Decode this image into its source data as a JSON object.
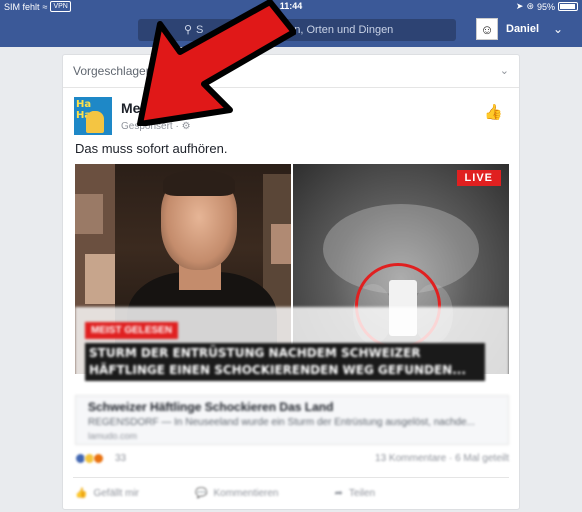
{
  "statusbar": {
    "carrier": "SIM fehlt",
    "vpn": "VPN",
    "time": "11:44",
    "battery": "95%"
  },
  "navbar": {
    "search_placeholder_visible": "S",
    "search_placeholder_rest": "nen, Orten und Dingen",
    "user_name": "Daniel"
  },
  "card": {
    "header": "Vorgeschlagen",
    "page_name": "Mega",
    "avatar_text": "Ha Ha!",
    "sponsored": "Gesponsert",
    "post_text": "Das muss sofort aufhören.",
    "live_badge": "LIVE",
    "tag": "MEIST GELESEN",
    "headline": "STURM DER ENTRÜSTUNG NACHDEM SCHWEIZER HÄFTLINGE EINEN SCHOCKIERENDEN WEG GEFUNDEN...",
    "link_title": "Schweizer Häftlinge Schockieren Das Land",
    "link_desc": "REGENSDORF — In Neuseeland wurde ein Sturm der Entrüstung ausgelöst, nachde...",
    "link_source": "lamudo.com",
    "reaction_count": "33",
    "comments": "13 Kommentare",
    "shares": "6 Mal geteilt",
    "actions": {
      "like": "Gefällt mir",
      "comment": "Kommentieren",
      "share": "Teilen"
    }
  },
  "colors": {
    "brand": "#3b5998",
    "live": "#e02020",
    "arrow": "#e01818"
  }
}
